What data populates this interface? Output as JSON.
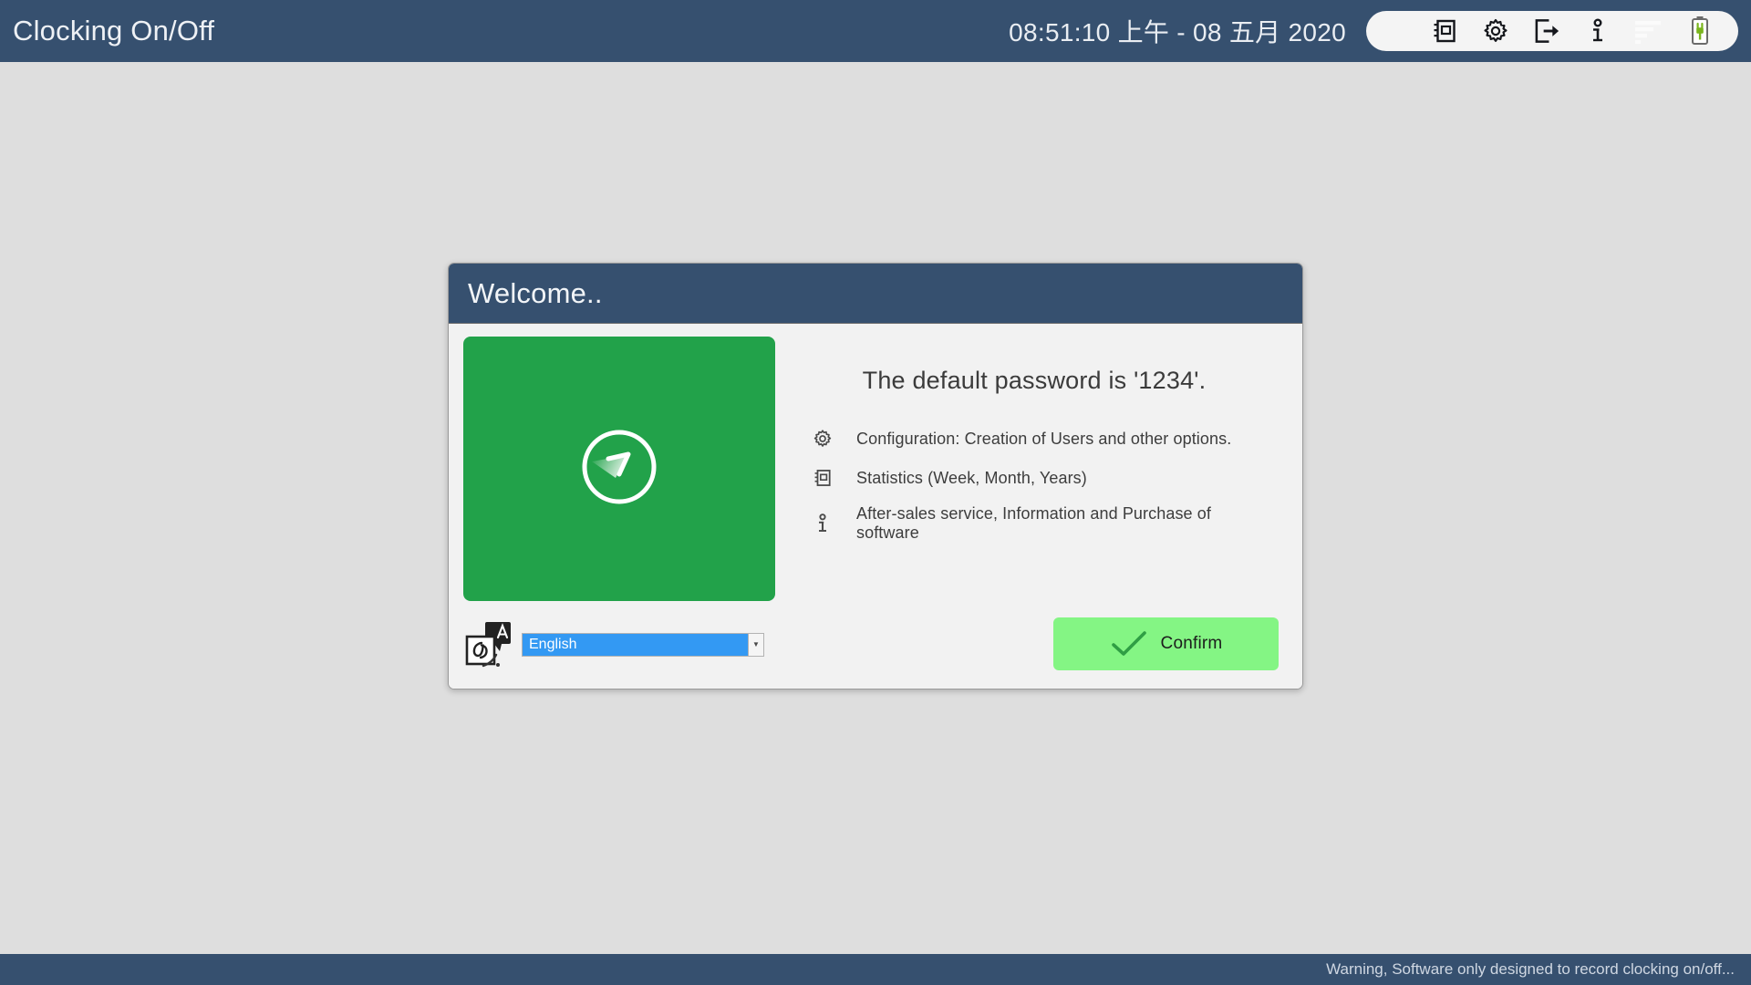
{
  "window": {
    "app_title": "Clocking On/Off",
    "clock": "08:51:10 上午 - 08 五月 2020"
  },
  "toolbar": {
    "items": [
      {
        "name": "statistics-icon",
        "label": "Statistics"
      },
      {
        "name": "gear-icon",
        "label": "Configuration"
      },
      {
        "name": "exit-icon",
        "label": "Exit"
      },
      {
        "name": "info-icon",
        "label": "Information"
      },
      {
        "name": "bar-chart-icon",
        "label": "Chart"
      },
      {
        "name": "battery-icon",
        "label": "Battery"
      }
    ]
  },
  "dialog": {
    "title": "Welcome..",
    "password_note": "The default password is '1234'.",
    "features": [
      {
        "icon": "gear-icon",
        "text": "Configuration: Creation of Users and other options."
      },
      {
        "icon": "statistics-icon",
        "text": "Statistics (Week, Month, Years)"
      },
      {
        "icon": "info-icon",
        "text": "After-sales service, Information and Purchase of software"
      }
    ],
    "language": {
      "icon": "translate-icon",
      "selected": "English",
      "dropdown_arrow": "▼"
    },
    "confirm_button": {
      "label": "Confirm",
      "icon": "check-icon"
    }
  },
  "statusbar": {
    "warning": "Warning, Software only designed to record clocking on/off..."
  },
  "colors": {
    "header_blue": "#36506f",
    "desktop_gray": "#dedede",
    "panel_green": "#22a24a",
    "confirm_green": "#84f584",
    "select_blue": "#3399f3",
    "dialog_bg": "#f2f2f2"
  }
}
